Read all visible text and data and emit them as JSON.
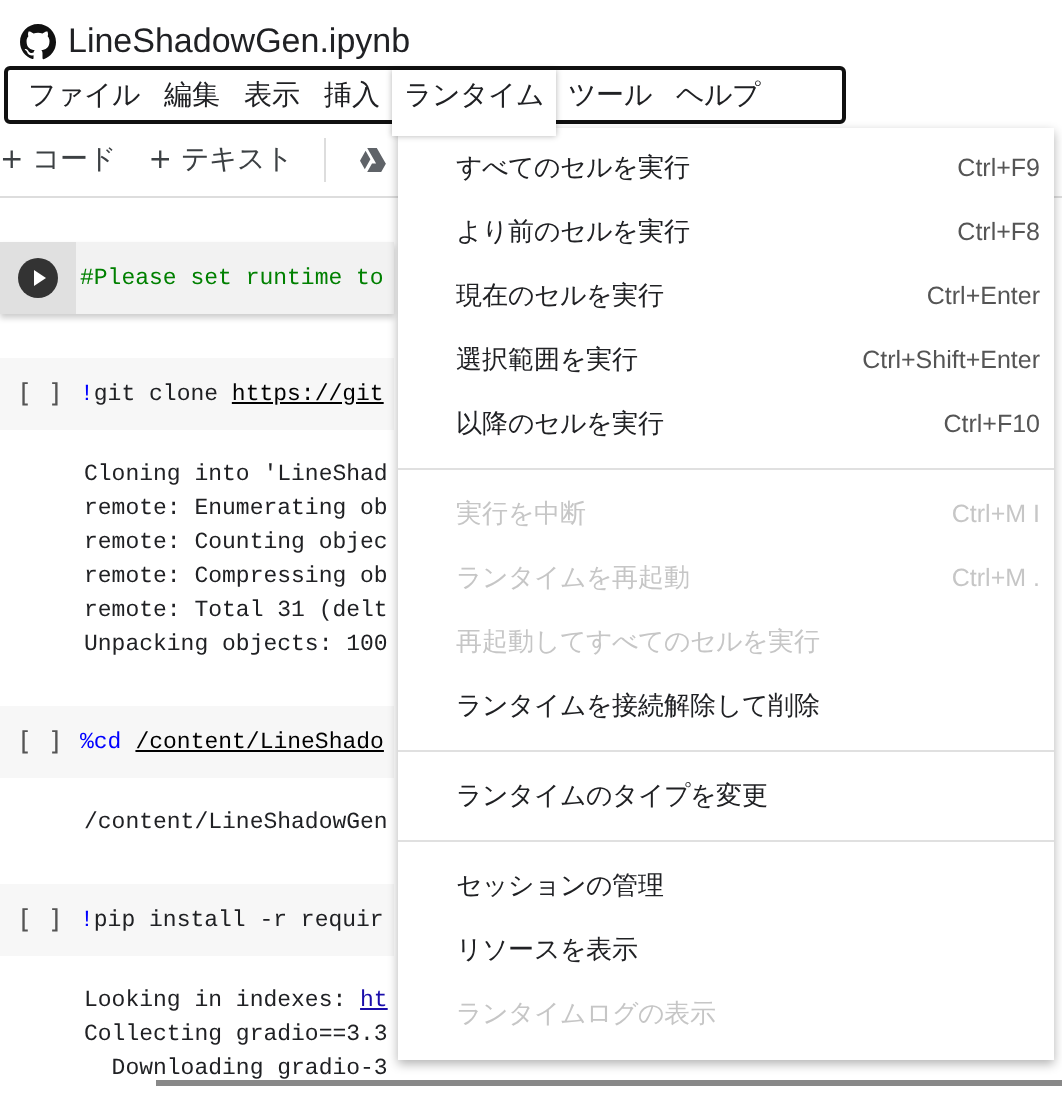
{
  "title": "LineShadowGen.ipynb",
  "menubar": [
    {
      "label": "ファイル",
      "selected": false
    },
    {
      "label": "編集",
      "selected": false
    },
    {
      "label": "表示",
      "selected": false
    },
    {
      "label": "挿入",
      "selected": false
    },
    {
      "label": "ランタイム",
      "selected": true
    },
    {
      "label": "ツール",
      "selected": false
    },
    {
      "label": "ヘルプ",
      "selected": false
    }
  ],
  "toolbar": {
    "add_code": "+ コード",
    "add_text": "+ テキスト"
  },
  "cells": [
    {
      "kind": "focused",
      "code": {
        "comment": "#Please set runtime to"
      }
    },
    {
      "kind": "plain",
      "status": "[ ]",
      "code": {
        "magic": "!",
        "command": "git clone ",
        "link": "https://git"
      },
      "output": [
        "Cloning into 'LineShad",
        "remote: Enumerating ob",
        "remote: Counting objec",
        "remote: Compressing ob",
        "remote: Total 31 (delt",
        "Unpacking objects: 100"
      ]
    },
    {
      "kind": "plain",
      "status": "[ ]",
      "code": {
        "magic": "%cd",
        "link": "/content/LineShado"
      },
      "output": [
        "/content/LineShadowGen"
      ]
    },
    {
      "kind": "plain",
      "status": "[ ]",
      "code": {
        "magic": "!",
        "command": "pip install -r requir"
      },
      "output": [
        {
          "text": "Looking in indexes: ",
          "link": "ht"
        },
        "Collecting gradio==3.3",
        "  Downloading gradio-3"
      ]
    }
  ],
  "menu": [
    [
      {
        "label": "すべてのセルを実行",
        "shortcut": "Ctrl+F9",
        "disabled": false
      },
      {
        "label": "より前のセルを実行",
        "shortcut": "Ctrl+F8",
        "disabled": false
      },
      {
        "label": "現在のセルを実行",
        "shortcut": "Ctrl+Enter",
        "disabled": false
      },
      {
        "label": "選択範囲を実行",
        "shortcut": "Ctrl+Shift+Enter",
        "disabled": false
      },
      {
        "label": "以降のセルを実行",
        "shortcut": "Ctrl+F10",
        "disabled": false
      }
    ],
    [
      {
        "label": "実行を中断",
        "shortcut": "Ctrl+M I",
        "disabled": true
      },
      {
        "label": "ランタイムを再起動",
        "shortcut": "Ctrl+M .",
        "disabled": true
      },
      {
        "label": "再起動してすべてのセルを実行",
        "disabled": true
      },
      {
        "label": "ランタイムを接続解除して削除",
        "disabled": false
      }
    ],
    [
      {
        "label": "ランタイムのタイプを変更",
        "disabled": false
      }
    ],
    [
      {
        "label": "セッションの管理",
        "disabled": false
      },
      {
        "label": "リソースを表示",
        "disabled": false
      },
      {
        "label": "ランタイムログの表示",
        "disabled": true
      }
    ]
  ]
}
